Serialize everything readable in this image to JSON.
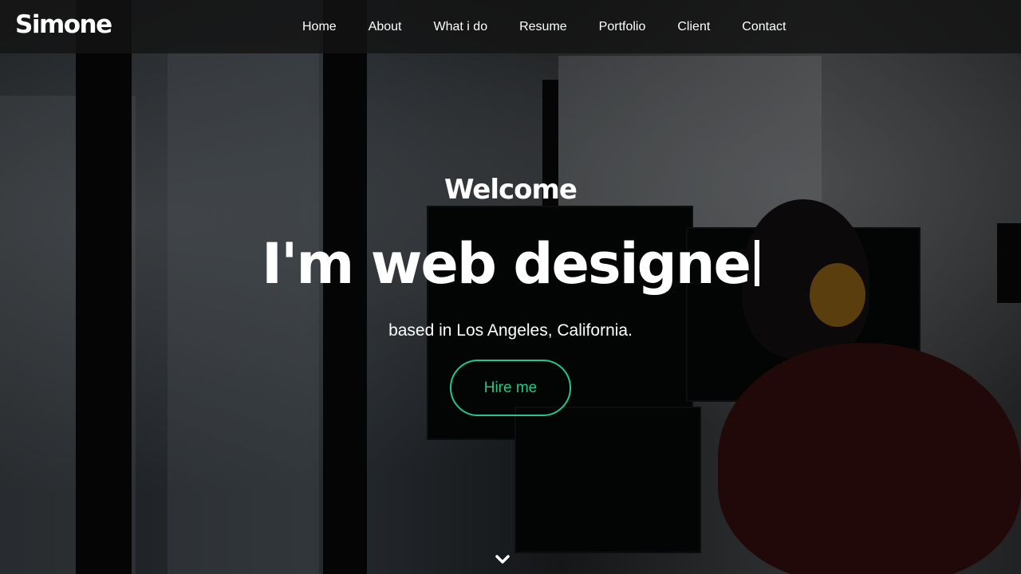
{
  "header": {
    "logo": "Simone",
    "nav": [
      "Home",
      "About",
      "What i do",
      "Resume",
      "Portfolio",
      "Client",
      "Contact"
    ]
  },
  "hero": {
    "welcome": "Welcome",
    "title": "I'm web designe",
    "subtitle": "based in Los Angeles, California.",
    "cta_label": "Hire me",
    "scroll_icon": "chevron-down-icon"
  },
  "colors": {
    "accent": "#20c98a",
    "nav_background": "#141414",
    "text": "#ffffff"
  }
}
